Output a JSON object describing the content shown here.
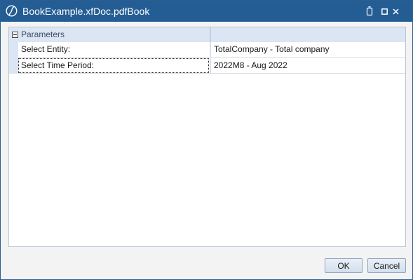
{
  "window": {
    "title": "BookExample.xfDoc.pdfBook",
    "app_icon": "onestream-logo-icon",
    "controls": [
      "pin-icon",
      "maximize-icon",
      "close-icon"
    ]
  },
  "parameters": {
    "group_label": "Parameters",
    "rows": [
      {
        "label": "Select Entity:",
        "value": "TotalCompany - Total company"
      },
      {
        "label": "Select Time Period:",
        "value": "2022M8 - Aug 2022"
      }
    ]
  },
  "buttons": {
    "ok_label": "OK",
    "cancel_label": "Cancel"
  },
  "colors": {
    "titlebar": "#245d94",
    "group_header": "#dbe5f3",
    "button_border": "#8fa6c1"
  }
}
